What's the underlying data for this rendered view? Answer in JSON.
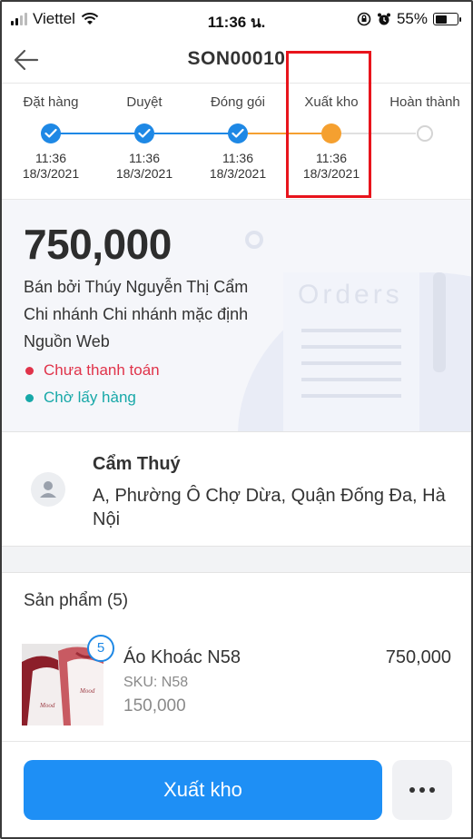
{
  "status_bar": {
    "carrier": "Viettel",
    "time": "11:36 น.",
    "battery": "55%",
    "battery_level": 0.55
  },
  "header": {
    "title": "SON00010",
    "back_icon": "back-arrow-icon"
  },
  "progress": {
    "steps": [
      {
        "label": "Đặt hàng",
        "time": "11:36",
        "date": "18/3/2021",
        "state": "done"
      },
      {
        "label": "Duyệt",
        "time": "11:36",
        "date": "18/3/2021",
        "state": "done"
      },
      {
        "label": "Đóng gói",
        "time": "11:36",
        "date": "18/3/2021",
        "state": "done"
      },
      {
        "label": "Xuất kho",
        "time": "11:36",
        "date": "18/3/2021",
        "state": "current"
      },
      {
        "label": "Hoàn thành",
        "time": "",
        "date": "",
        "state": "pending"
      }
    ],
    "colors": {
      "done": "#1e88e5",
      "current": "#f5a030",
      "pending": "#d4d4d4",
      "highlight": "#e8141c"
    }
  },
  "summary": {
    "amount": "750,000",
    "sold_by": "Bán bởi Thúy Nguyễn Thị Cẩm",
    "branch": "Chi nhánh Chi nhánh mặc định",
    "source": "Nguồn Web",
    "payment_status": "Chưa thanh toán",
    "payment_color": "#e0334a",
    "fulfillment_status": "Chờ lấy hàng",
    "fulfillment_color": "#17a8a8",
    "watermark": "Orders"
  },
  "customer": {
    "name": "Cẩm Thuý",
    "address": "A, Phường Ô Chợ Dừa, Quận Đống Đa, Hà Nội"
  },
  "products": {
    "header": "Sản phẩm (5)",
    "items": [
      {
        "name": "Áo Khoác N58",
        "sku": "SKU: N58",
        "unit_price": "150,000",
        "total": "750,000",
        "quantity": "5"
      }
    ]
  },
  "actions": {
    "primary": "Xuất kho",
    "more_icon": "more-dots-icon"
  }
}
